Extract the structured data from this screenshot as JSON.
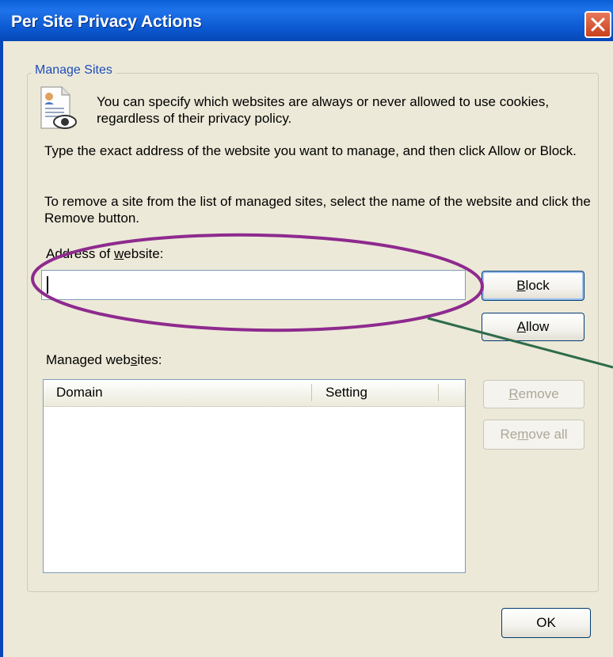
{
  "window": {
    "title": "Per Site Privacy Actions"
  },
  "group": {
    "legend": "Manage Sites",
    "intro": "You can specify which websites are always or never allowed to use cookies, regardless of their privacy policy.",
    "instructions_add": "Type the exact address of the website you want to manage, and then click Allow or Block.",
    "instructions_remove": "To remove a site from the list of managed sites, select the name of the website and click the Remove button."
  },
  "address": {
    "label_pre": "Address of ",
    "label_accel": "w",
    "label_post": "ebsite:",
    "value": ""
  },
  "buttons": {
    "block": {
      "accel": "B",
      "rest": "lock"
    },
    "allow": {
      "accel": "A",
      "rest": "llow"
    },
    "remove": {
      "accel": "R",
      "rest": "emove"
    },
    "remove_all": {
      "pre": "Re",
      "accel": "m",
      "rest": "ove all"
    },
    "ok": "OK"
  },
  "managed": {
    "label_pre": "Managed web",
    "label_accel": "s",
    "label_post": "ites:",
    "columns": [
      "Domain",
      "Setting"
    ],
    "rows": []
  },
  "colors": {
    "titlebar": "#0a5fd8",
    "annotation": "#8e2a8e",
    "legend_text": "#1e4dba"
  },
  "icons": [
    "close-icon",
    "privacy-document-icon"
  ]
}
